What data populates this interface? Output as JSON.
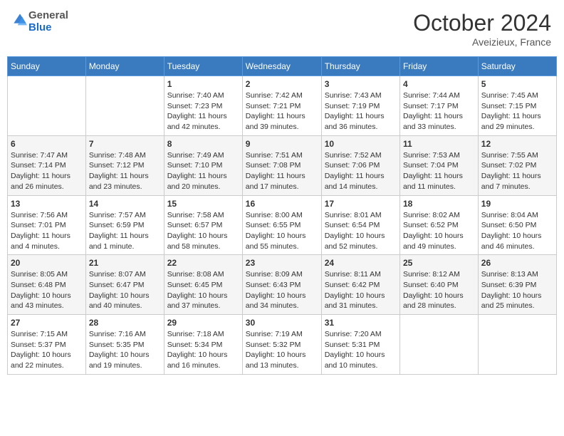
{
  "header": {
    "logo_line1": "General",
    "logo_line2": "Blue",
    "month": "October 2024",
    "location": "Aveizieux, France"
  },
  "weekdays": [
    "Sunday",
    "Monday",
    "Tuesday",
    "Wednesday",
    "Thursday",
    "Friday",
    "Saturday"
  ],
  "weeks": [
    [
      {
        "day": "",
        "info": ""
      },
      {
        "day": "",
        "info": ""
      },
      {
        "day": "1",
        "info": "Sunrise: 7:40 AM\nSunset: 7:23 PM\nDaylight: 11 hours and 42 minutes."
      },
      {
        "day": "2",
        "info": "Sunrise: 7:42 AM\nSunset: 7:21 PM\nDaylight: 11 hours and 39 minutes."
      },
      {
        "day": "3",
        "info": "Sunrise: 7:43 AM\nSunset: 7:19 PM\nDaylight: 11 hours and 36 minutes."
      },
      {
        "day": "4",
        "info": "Sunrise: 7:44 AM\nSunset: 7:17 PM\nDaylight: 11 hours and 33 minutes."
      },
      {
        "day": "5",
        "info": "Sunrise: 7:45 AM\nSunset: 7:15 PM\nDaylight: 11 hours and 29 minutes."
      }
    ],
    [
      {
        "day": "6",
        "info": "Sunrise: 7:47 AM\nSunset: 7:14 PM\nDaylight: 11 hours and 26 minutes."
      },
      {
        "day": "7",
        "info": "Sunrise: 7:48 AM\nSunset: 7:12 PM\nDaylight: 11 hours and 23 minutes."
      },
      {
        "day": "8",
        "info": "Sunrise: 7:49 AM\nSunset: 7:10 PM\nDaylight: 11 hours and 20 minutes."
      },
      {
        "day": "9",
        "info": "Sunrise: 7:51 AM\nSunset: 7:08 PM\nDaylight: 11 hours and 17 minutes."
      },
      {
        "day": "10",
        "info": "Sunrise: 7:52 AM\nSunset: 7:06 PM\nDaylight: 11 hours and 14 minutes."
      },
      {
        "day": "11",
        "info": "Sunrise: 7:53 AM\nSunset: 7:04 PM\nDaylight: 11 hours and 11 minutes."
      },
      {
        "day": "12",
        "info": "Sunrise: 7:55 AM\nSunset: 7:02 PM\nDaylight: 11 hours and 7 minutes."
      }
    ],
    [
      {
        "day": "13",
        "info": "Sunrise: 7:56 AM\nSunset: 7:01 PM\nDaylight: 11 hours and 4 minutes."
      },
      {
        "day": "14",
        "info": "Sunrise: 7:57 AM\nSunset: 6:59 PM\nDaylight: 11 hours and 1 minute."
      },
      {
        "day": "15",
        "info": "Sunrise: 7:58 AM\nSunset: 6:57 PM\nDaylight: 10 hours and 58 minutes."
      },
      {
        "day": "16",
        "info": "Sunrise: 8:00 AM\nSunset: 6:55 PM\nDaylight: 10 hours and 55 minutes."
      },
      {
        "day": "17",
        "info": "Sunrise: 8:01 AM\nSunset: 6:54 PM\nDaylight: 10 hours and 52 minutes."
      },
      {
        "day": "18",
        "info": "Sunrise: 8:02 AM\nSunset: 6:52 PM\nDaylight: 10 hours and 49 minutes."
      },
      {
        "day": "19",
        "info": "Sunrise: 8:04 AM\nSunset: 6:50 PM\nDaylight: 10 hours and 46 minutes."
      }
    ],
    [
      {
        "day": "20",
        "info": "Sunrise: 8:05 AM\nSunset: 6:48 PM\nDaylight: 10 hours and 43 minutes."
      },
      {
        "day": "21",
        "info": "Sunrise: 8:07 AM\nSunset: 6:47 PM\nDaylight: 10 hours and 40 minutes."
      },
      {
        "day": "22",
        "info": "Sunrise: 8:08 AM\nSunset: 6:45 PM\nDaylight: 10 hours and 37 minutes."
      },
      {
        "day": "23",
        "info": "Sunrise: 8:09 AM\nSunset: 6:43 PM\nDaylight: 10 hours and 34 minutes."
      },
      {
        "day": "24",
        "info": "Sunrise: 8:11 AM\nSunset: 6:42 PM\nDaylight: 10 hours and 31 minutes."
      },
      {
        "day": "25",
        "info": "Sunrise: 8:12 AM\nSunset: 6:40 PM\nDaylight: 10 hours and 28 minutes."
      },
      {
        "day": "26",
        "info": "Sunrise: 8:13 AM\nSunset: 6:39 PM\nDaylight: 10 hours and 25 minutes."
      }
    ],
    [
      {
        "day": "27",
        "info": "Sunrise: 7:15 AM\nSunset: 5:37 PM\nDaylight: 10 hours and 22 minutes."
      },
      {
        "day": "28",
        "info": "Sunrise: 7:16 AM\nSunset: 5:35 PM\nDaylight: 10 hours and 19 minutes."
      },
      {
        "day": "29",
        "info": "Sunrise: 7:18 AM\nSunset: 5:34 PM\nDaylight: 10 hours and 16 minutes."
      },
      {
        "day": "30",
        "info": "Sunrise: 7:19 AM\nSunset: 5:32 PM\nDaylight: 10 hours and 13 minutes."
      },
      {
        "day": "31",
        "info": "Sunrise: 7:20 AM\nSunset: 5:31 PM\nDaylight: 10 hours and 10 minutes."
      },
      {
        "day": "",
        "info": ""
      },
      {
        "day": "",
        "info": ""
      }
    ]
  ]
}
